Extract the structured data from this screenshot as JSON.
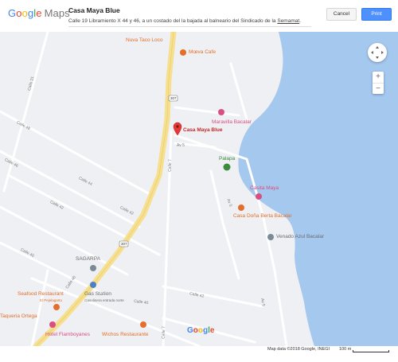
{
  "header": {
    "logo_google": [
      "G",
      "o",
      "o",
      "g",
      "l",
      "e"
    ],
    "logo_maps": "Maps",
    "place_title": "Casa Maya Blue",
    "address_prefix": "Calle 19 Libramiento X 44 y 46, a un costado del la bajada al balneario del Sindicado de la ",
    "address_link": "Semamat",
    "address_suffix": ".",
    "cancel_label": "Cancel",
    "print_label": "Print"
  },
  "map": {
    "pois": {
      "nuva_taco_loco": "Nuva Taco Loco",
      "mueva_cafe": "Mœva Cafe",
      "maravilla_bacalar": "Maravilla Bacalar",
      "casa_maya_blue": "Casa Maya Blue",
      "palapa": "Palapa",
      "casita_maya": "Casita Maya",
      "casa_dona_berta": "Casa Doña Berta Bacalar",
      "venado_azul": "Venado Azul Bacalar",
      "sagarpa": "SAGARPA",
      "seafood_restaurant": "Seafood Restaurant",
      "seafood_sub": "El Pejelagarto",
      "gas_station": "Gas Station",
      "gas_station_sub": "Gasolinera entrada norte",
      "taqueria_ortega": "Taqueria Ortega",
      "hotel_flamboyanes": "Hotel Flamboyanes",
      "wichos_restaurante": "Wichos Restaurante"
    },
    "streets": {
      "calle_21": "Calle 21",
      "calle_48": "Calle 48",
      "calle_46a": "Calle 46",
      "calle_44": "Calle 44",
      "calle_42": "Calle 42",
      "calle_40": "Calle 40",
      "calle_46b": "Calle 46",
      "calle_42b": "Calle 42",
      "av5a": "Av 5",
      "av5b": "Av 5",
      "av5c": "Av 5",
      "calle_7": "Calle 7",
      "calle_7b": "Calle 7",
      "calle_40b": "Calle 40",
      "calle_42c": "Calle 42",
      "hwy_a": "307",
      "hwy_b": "307"
    },
    "zoom_in": "+",
    "zoom_out": "−",
    "google_watermark": [
      "G",
      "o",
      "o",
      "g",
      "l",
      "e"
    ]
  },
  "footer": {
    "attribution": "Map data ©2018 Google, INEGI",
    "scale_label": "100 m"
  },
  "colors": {
    "water": "#a5c8ef",
    "highway": "#f6df8e",
    "land": "#eef0f3",
    "road": "#ffffff",
    "print_button": "#4d90fe",
    "pin_red": "#e53935",
    "poi_orange": "#e46f2c",
    "poi_pink": "#d94f83",
    "poi_green": "#3a8b3a"
  }
}
